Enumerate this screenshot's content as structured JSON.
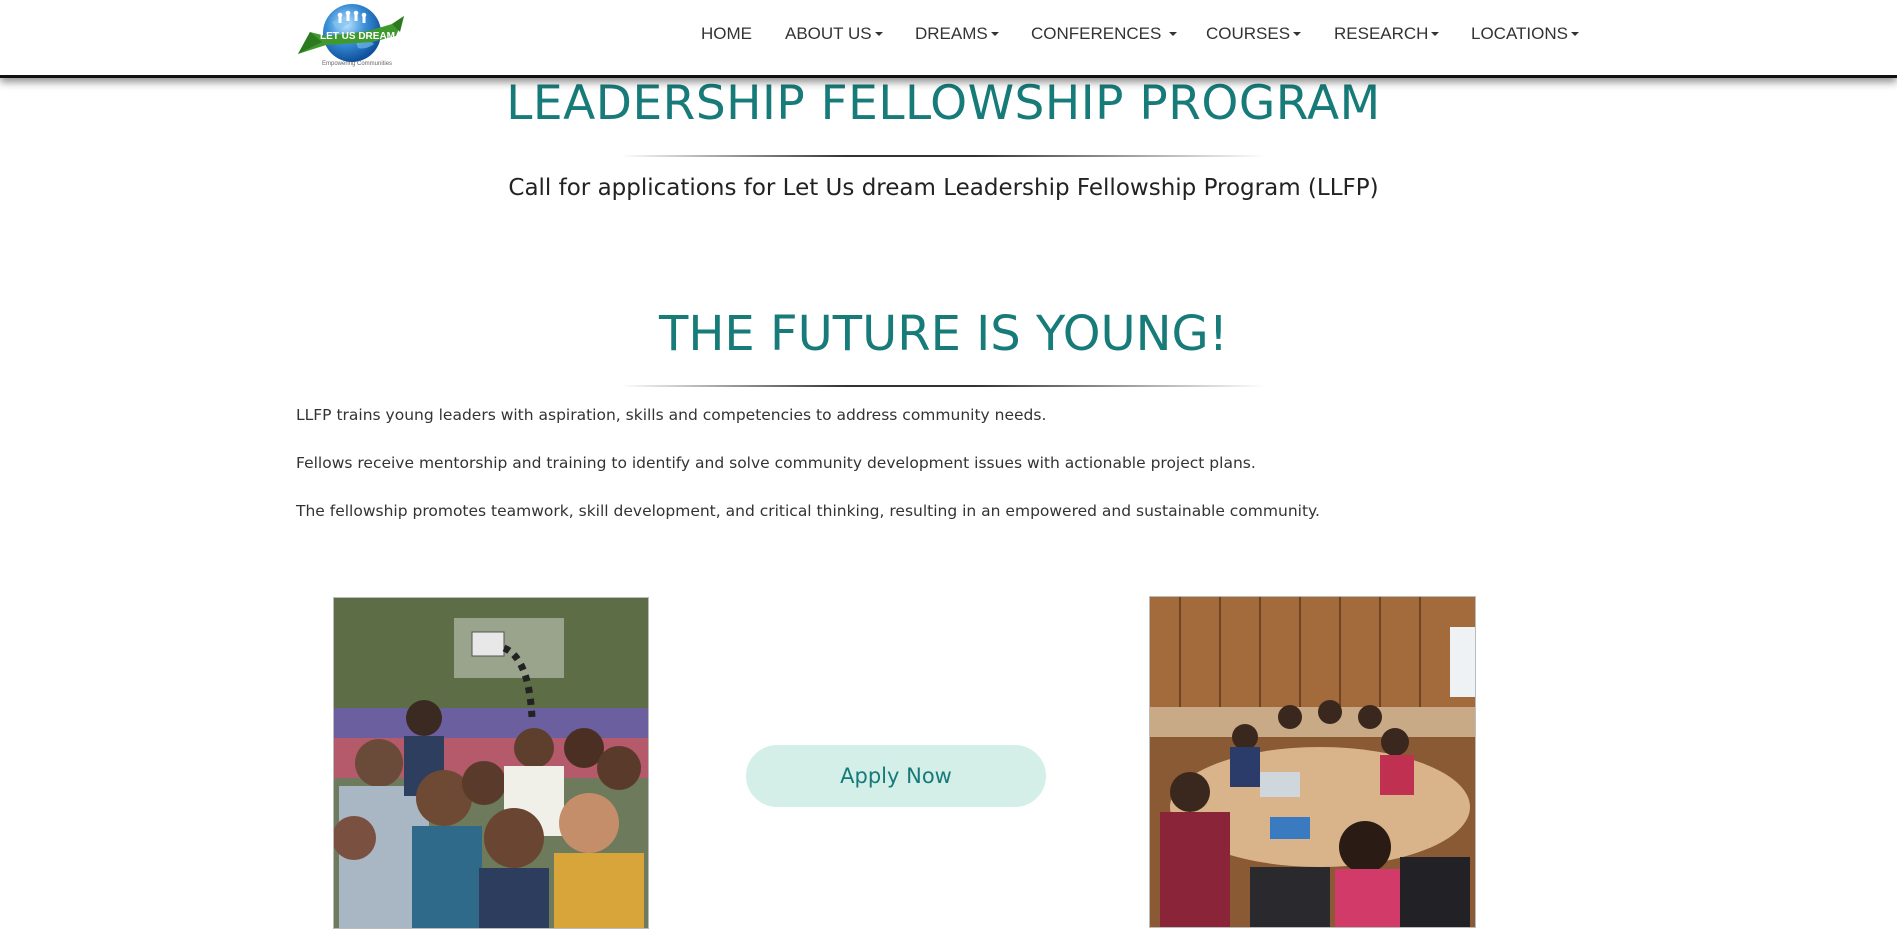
{
  "header": {
    "logo_text": "LET US DREAM",
    "logo_tagline": "Empowering Communities",
    "nav": [
      {
        "label": "HOME"
      },
      {
        "label": "ABOUT US"
      },
      {
        "label": "DREAMS"
      },
      {
        "label": "CONFERENCES"
      },
      {
        "label": "COURSES"
      },
      {
        "label": "RESEARCH"
      },
      {
        "label": "LOCATIONS"
      }
    ]
  },
  "hero": {
    "title": "LEADERSHIP FELLOWSHIP PROGRAM",
    "subtitle": "Call for applications for Let Us dream Leadership Fellowship Program (LLFP)"
  },
  "section": {
    "title": "THE FUTURE IS YOUNG!",
    "paragraphs": [
      "LLFP trains young leaders with aspiration, skills and competencies to address community needs.",
      "Fellows receive mentorship and training to identify and solve community development issues with actionable project plans.",
      "The fellowship promotes teamwork, skill development, and critical thinking, resulting in an empowered and sustainable community."
    ],
    "apply_label": "Apply Now"
  },
  "colors": {
    "accent": "#177b7a",
    "button_bg": "#d3efe7"
  }
}
